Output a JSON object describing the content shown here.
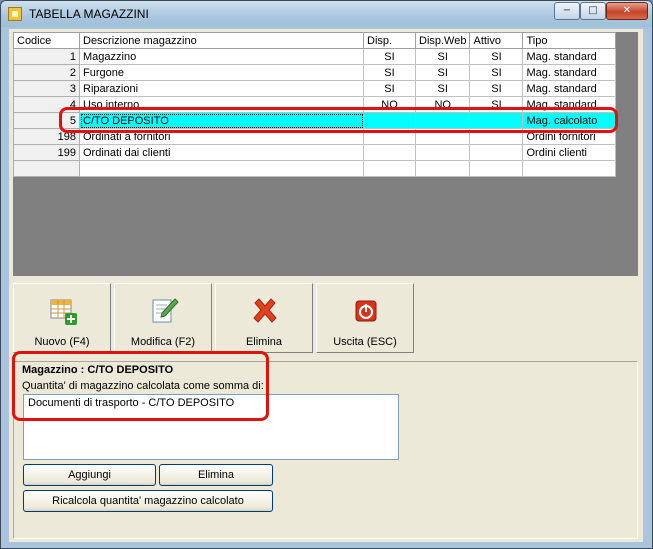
{
  "window": {
    "title": "TABELLA MAGAZZINI",
    "min_glyph": "−",
    "max_glyph": "□",
    "close_glyph": "✕"
  },
  "grid": {
    "headers": [
      "Codice",
      "Descrizione magazzino",
      "Disp.",
      "Disp.Web",
      "Attivo",
      "Tipo"
    ],
    "rows": [
      {
        "code": "1",
        "desc": "Magazzino",
        "disp": "SI",
        "dispweb": "SI",
        "attivo": "SI",
        "tipo": "Mag. standard"
      },
      {
        "code": "2",
        "desc": "Furgone",
        "disp": "SI",
        "dispweb": "SI",
        "attivo": "SI",
        "tipo": "Mag. standard"
      },
      {
        "code": "3",
        "desc": "Riparazioni",
        "disp": "SI",
        "dispweb": "SI",
        "attivo": "SI",
        "tipo": "Mag. standard"
      },
      {
        "code": "4",
        "desc": "Uso interno",
        "disp": "NO",
        "dispweb": "NO",
        "attivo": "SI",
        "tipo": "Mag. standard"
      },
      {
        "code": "5",
        "desc": "C/TO DEPOSITO",
        "disp": "",
        "dispweb": "",
        "attivo": "",
        "tipo": "Mag. calcolato",
        "selected": true
      },
      {
        "code": "198",
        "desc": "Ordinati a fornitori",
        "disp": "",
        "dispweb": "",
        "attivo": "",
        "tipo": "Ordini fornitori"
      },
      {
        "code": "199",
        "desc": "Ordinati dai clienti",
        "disp": "",
        "dispweb": "",
        "attivo": "",
        "tipo": "Ordini clienti"
      }
    ]
  },
  "toolbar": {
    "new_label": "Nuovo (F4)",
    "edit_label": "Modifica (F2)",
    "delete_label": "Elimina",
    "exit_label": "Uscita (ESC)"
  },
  "details": {
    "title": "Magazzino : C/TO DEPOSITO",
    "subtitle": "Quantita' di magazzino calcolata come somma di:",
    "items": [
      "Documenti di trasporto - C/TO DEPOSITO"
    ],
    "add_label": "Aggiungi",
    "remove_label": "Elimina",
    "recalc_label": "Ricalcola quantita' magazzino calcolato"
  },
  "colors": {
    "selection": "#00ffff",
    "highlight": "#e0120c"
  }
}
